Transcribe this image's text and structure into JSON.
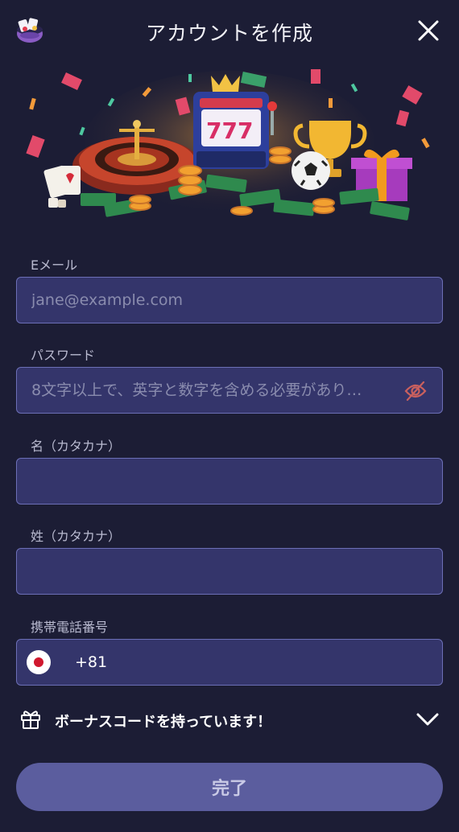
{
  "header": {
    "title": "アカウントを作成",
    "logo_icon": "casino-bowl-logo-icon",
    "close_icon": "close-icon"
  },
  "hero": {
    "image": "casino-illustration"
  },
  "form": {
    "email": {
      "label": "Eメール",
      "placeholder": "jane@example.com",
      "value": ""
    },
    "password": {
      "label": "パスワード",
      "placeholder": "8文字以上で、英字と数字を含める必要があり…",
      "value": "",
      "toggle_icon": "eye-off-icon"
    },
    "first_name": {
      "label": "名（カタカナ）",
      "value": ""
    },
    "last_name": {
      "label": "姓（カタカナ）",
      "value": ""
    },
    "phone": {
      "label": "携帯電話番号",
      "country_flag": "japan-flag-icon",
      "country_code": "+81",
      "value": ""
    }
  },
  "bonus": {
    "label": "ボーナスコードを持っています！",
    "icon": "gift-icon",
    "chevron": "chevron-down-icon"
  },
  "submit": {
    "label": "完了"
  },
  "colors": {
    "background": "#1c1d35",
    "field_bg": "#34356b",
    "field_border": "#6c6fb6",
    "button_bg": "#5b5d9e",
    "eye_icon": "#c9605e"
  }
}
